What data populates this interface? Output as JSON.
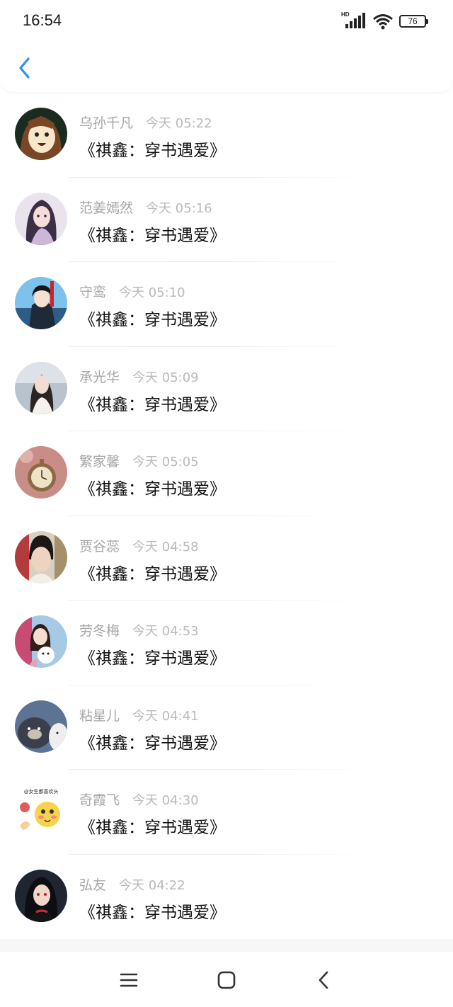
{
  "status_bar": {
    "time": "16:54",
    "network_label": "HD",
    "battery": "76"
  },
  "header": {
    "back_icon": "chevron-left-icon",
    "accent_color": "#2b8ff2"
  },
  "conversations": [
    {
      "name": "乌孙千凡",
      "time": "今天 05:22",
      "message": "《祺鑫：穿书遇爱》",
      "avatar": "cartoon-girl-brown-hair"
    },
    {
      "name": "范姜嫣然",
      "time": "今天 05:16",
      "message": "《祺鑫：穿书遇爱》",
      "avatar": "anime-girl-dark-hair"
    },
    {
      "name": "守鸾",
      "time": "今天 05:10",
      "message": "《祺鑫：穿书遇爱》",
      "avatar": "anime-boy-blue-sky"
    },
    {
      "name": "承光华",
      "time": "今天 05:09",
      "message": "《祺鑫：穿书遇爱》",
      "avatar": "girl-seaside-photo"
    },
    {
      "name": "繁家馨",
      "time": "今天 05:05",
      "message": "《祺鑫：穿书遇爱》",
      "avatar": "pocket-watch-photo"
    },
    {
      "name": "贾谷蕊",
      "time": "今天 04:58",
      "message": "《祺鑫：穿书遇爱》",
      "avatar": "woman-selfie-photo"
    },
    {
      "name": "劳冬梅",
      "time": "今天 04:53",
      "message": "《祺鑫：穿书遇爱》",
      "avatar": "girl-with-dog-photo"
    },
    {
      "name": "粘星儿",
      "time": "今天 04:41",
      "message": "《祺鑫：穿书遇爱》",
      "avatar": "cartoon-bears"
    },
    {
      "name": "奇霞飞",
      "time": "今天 04:30",
      "message": "《祺鑫：穿书遇爱》",
      "avatar": "emoji-sticker",
      "avatar_text": "@女生都喜欢头"
    },
    {
      "name": "弘友",
      "time": "今天 04:22",
      "message": "《祺鑫：穿书遇爱》",
      "avatar": "anime-ninja-dark"
    }
  ],
  "nav_bar": {
    "menu_icon": "menu-icon",
    "home_icon": "home-square-icon",
    "back_icon": "back-triangle-icon"
  }
}
